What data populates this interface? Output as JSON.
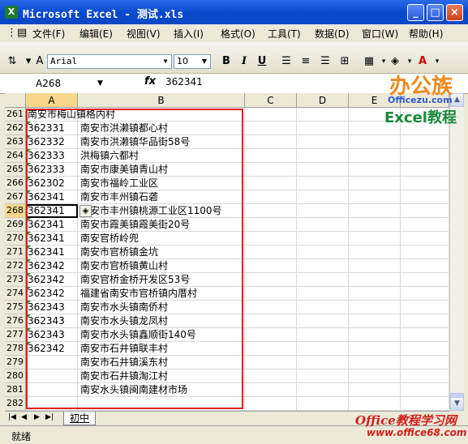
{
  "window": {
    "title": "Microsoft Excel - 测试.xls",
    "app_icon": "excel-icon",
    "controls": [
      "_",
      "□",
      "×"
    ]
  },
  "menu": {
    "items": [
      "文件(F)",
      "编辑(E)",
      "视图(V)",
      "插入(I)",
      "格式(O)",
      "工具(T)",
      "数据(D)",
      "窗口(W)",
      "帮助(H)"
    ],
    "doc_controls": [
      "_",
      "⊡",
      "×"
    ]
  },
  "toolbar": {
    "font_name": "Arial",
    "font_size": "10",
    "bold": "B",
    "italic": "I",
    "underline": "U",
    "font_color_label": "A"
  },
  "formula_bar": {
    "name_box": "A268",
    "fx_label": "fx",
    "value": "362341"
  },
  "grid": {
    "columns": [
      "A",
      "B",
      "C",
      "D",
      "E"
    ],
    "active_row": "268",
    "rows": [
      {
        "num": "261",
        "a": "南安市梅山镇格内村",
        "b": ""
      },
      {
        "num": "262",
        "a": "362331",
        "b": "南安市洪濑镇都心村"
      },
      {
        "num": "263",
        "a": "362332",
        "b": "南安市洪濑镇华品街58号"
      },
      {
        "num": "264",
        "a": "362333",
        "b": "洪梅镇六都村"
      },
      {
        "num": "265",
        "a": "362333",
        "b": "南安市康美镇青山村"
      },
      {
        "num": "266",
        "a": "362302",
        "b": "南安市福岭工业区"
      },
      {
        "num": "267",
        "a": "362341",
        "b": "南安市丰州镇石砻"
      },
      {
        "num": "268",
        "a": "362341",
        "b": "南安市丰州镇桃源工业区1100号"
      },
      {
        "num": "269",
        "a": "362341",
        "b": "南安市霞美镇霞美街20号"
      },
      {
        "num": "270",
        "a": "362341",
        "b": "南安官桥岭兜"
      },
      {
        "num": "271",
        "a": "362341",
        "b": "南安市官桥镇金坑"
      },
      {
        "num": "272",
        "a": "362342",
        "b": "南安市官桥镇黄山村"
      },
      {
        "num": "273",
        "a": "362342",
        "b": "南安官桥金桥开发区53号"
      },
      {
        "num": "274",
        "a": "362342",
        "b": "福建省南安市官桥镇内厝村"
      },
      {
        "num": "275",
        "a": "362343",
        "b": "南安市水头镇南侨村"
      },
      {
        "num": "276",
        "a": "362343",
        "b": "南安市水头镇龙凤村"
      },
      {
        "num": "277",
        "a": "362343",
        "b": "南安市水头镇鑫顺街140号"
      },
      {
        "num": "278",
        "a": "362342",
        "b": "南安市石井镇联丰村"
      },
      {
        "num": "279",
        "a": "",
        "b": "南安市石井镇溪东村"
      },
      {
        "num": "280",
        "a": "",
        "b": "南安市石井镇淘江村"
      },
      {
        "num": "281",
        "a": "",
        "b": "南安水头镇闽南建材市场"
      },
      {
        "num": "282",
        "a": "",
        "b": ""
      }
    ]
  },
  "sheet_tabs": {
    "nav": [
      "|◀",
      "◀",
      "▶",
      "▶|"
    ],
    "active_tab": "初中"
  },
  "status": {
    "text": "就绪"
  },
  "watermarks": {
    "logo_text": "办公族",
    "logo_url": "Officezu.com",
    "excel_label": "Excel教程",
    "bottom_text": "Office教程学习网",
    "bottom_url": "www.office68.com"
  },
  "colors": {
    "title_bar": "#0a4ad0",
    "highlight_box": "#e0201c",
    "error_triangle": "#1f8a2e",
    "logo_orange": "#f08a1c",
    "logo_blue": "#2a5ad0",
    "excel_green": "#1a8a3a",
    "bottom_red": "#d0201c"
  }
}
